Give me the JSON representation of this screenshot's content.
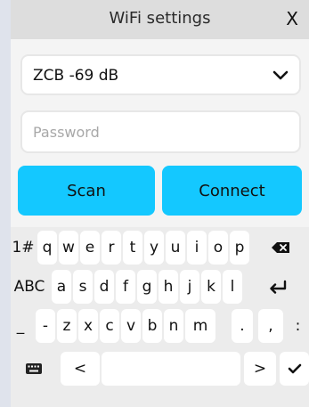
{
  "header": {
    "title": "WiFi settings",
    "close_label": "X"
  },
  "network_select": {
    "selected": "ZCB -69 dB",
    "icon": "chevron-down-icon"
  },
  "password": {
    "placeholder": "Password",
    "value": ""
  },
  "buttons": {
    "scan": "Scan",
    "connect": "Connect"
  },
  "keyboard": {
    "row1": [
      "1#",
      "q",
      "w",
      "e",
      "r",
      "t",
      "y",
      "u",
      "i",
      "o",
      "p"
    ],
    "row2": [
      "ABC",
      "a",
      "s",
      "d",
      "f",
      "g",
      "h",
      "j",
      "k",
      "l"
    ],
    "row3": [
      "_",
      "-",
      "z",
      "x",
      "c",
      "v",
      "b",
      "n",
      "m",
      ".",
      ",",
      ":"
    ],
    "row4": [
      "<",
      ">"
    ],
    "icons": [
      "backspace-icon",
      "enter-icon",
      "keyboard-icon",
      "checkmark-icon"
    ]
  },
  "colors": {
    "accent": "#14c8ff",
    "background": "#dfe3ec",
    "panel": "#f4f4f4"
  }
}
